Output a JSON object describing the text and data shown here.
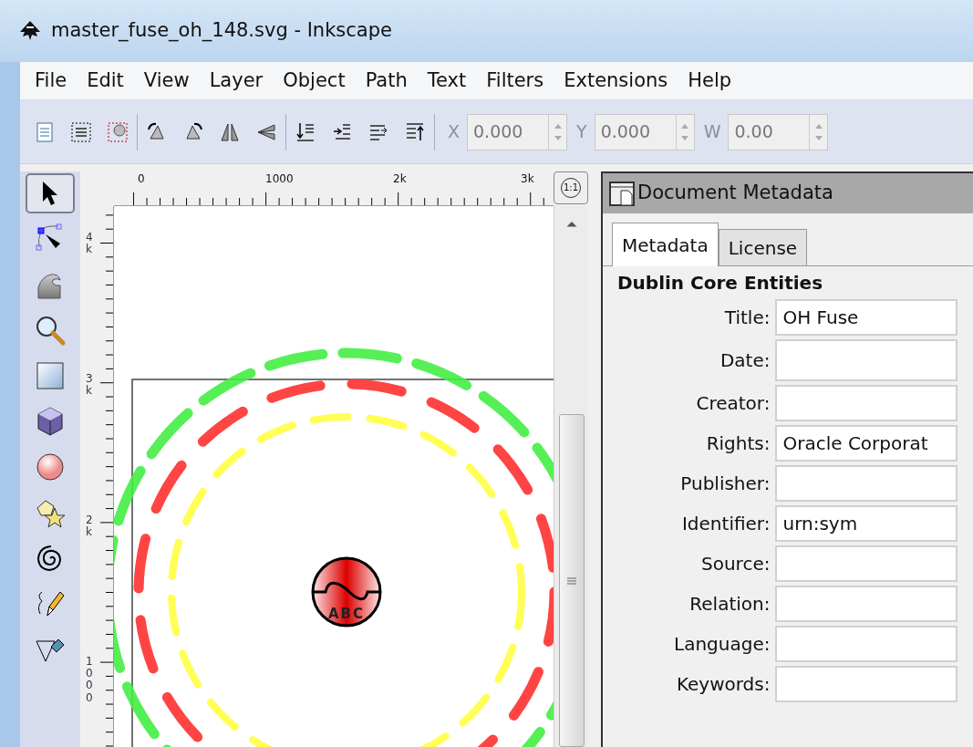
{
  "window": {
    "title": "master_fuse_oh_148.svg - Inkscape"
  },
  "menu": [
    "File",
    "Edit",
    "View",
    "Layer",
    "Object",
    "Path",
    "Text",
    "Filters",
    "Extensions",
    "Help"
  ],
  "coords": [
    {
      "label": "X",
      "value": "0.000"
    },
    {
      "label": "Y",
      "value": "0.000"
    },
    {
      "label": "W",
      "value": "0.00"
    }
  ],
  "tools": [
    {
      "kind": "select",
      "selected": true
    },
    {
      "kind": "node",
      "selected": false
    },
    {
      "kind": "tweak",
      "selected": false
    },
    {
      "kind": "zoom",
      "selected": false
    },
    {
      "kind": "rect",
      "selected": false
    },
    {
      "kind": "box3d",
      "selected": false
    },
    {
      "kind": "ellipse",
      "selected": false
    },
    {
      "kind": "star",
      "selected": false
    },
    {
      "kind": "spiral",
      "selected": false
    },
    {
      "kind": "pencil",
      "selected": false
    },
    {
      "kind": "pen",
      "selected": false
    }
  ],
  "canvas": {
    "hruler": [
      "0",
      "1000",
      "2k",
      "3k"
    ],
    "vruler": [
      "4k",
      "3k",
      "2k",
      "1000"
    ],
    "symbol_text": "ABC",
    "zoom_label": "1:1"
  },
  "panel": {
    "title": "Document Metadata",
    "tabs": [
      {
        "label": "Metadata",
        "selected": true
      },
      {
        "label": "License",
        "selected": false
      }
    ],
    "section": "Dublin Core Entities",
    "fields": [
      {
        "label": "Title:",
        "value": "OH Fuse"
      },
      {
        "label": "Date:"
      },
      {
        "label": "Creator:"
      },
      {
        "label": "Rights:",
        "value": "Oracle Corporat"
      },
      {
        "label": "Publisher:"
      },
      {
        "label": "Identifier:",
        "value": "urn:sym"
      },
      {
        "label": "Source:"
      },
      {
        "label": "Relation:"
      },
      {
        "label": "Language:"
      },
      {
        "label": "Keywords:"
      }
    ]
  }
}
